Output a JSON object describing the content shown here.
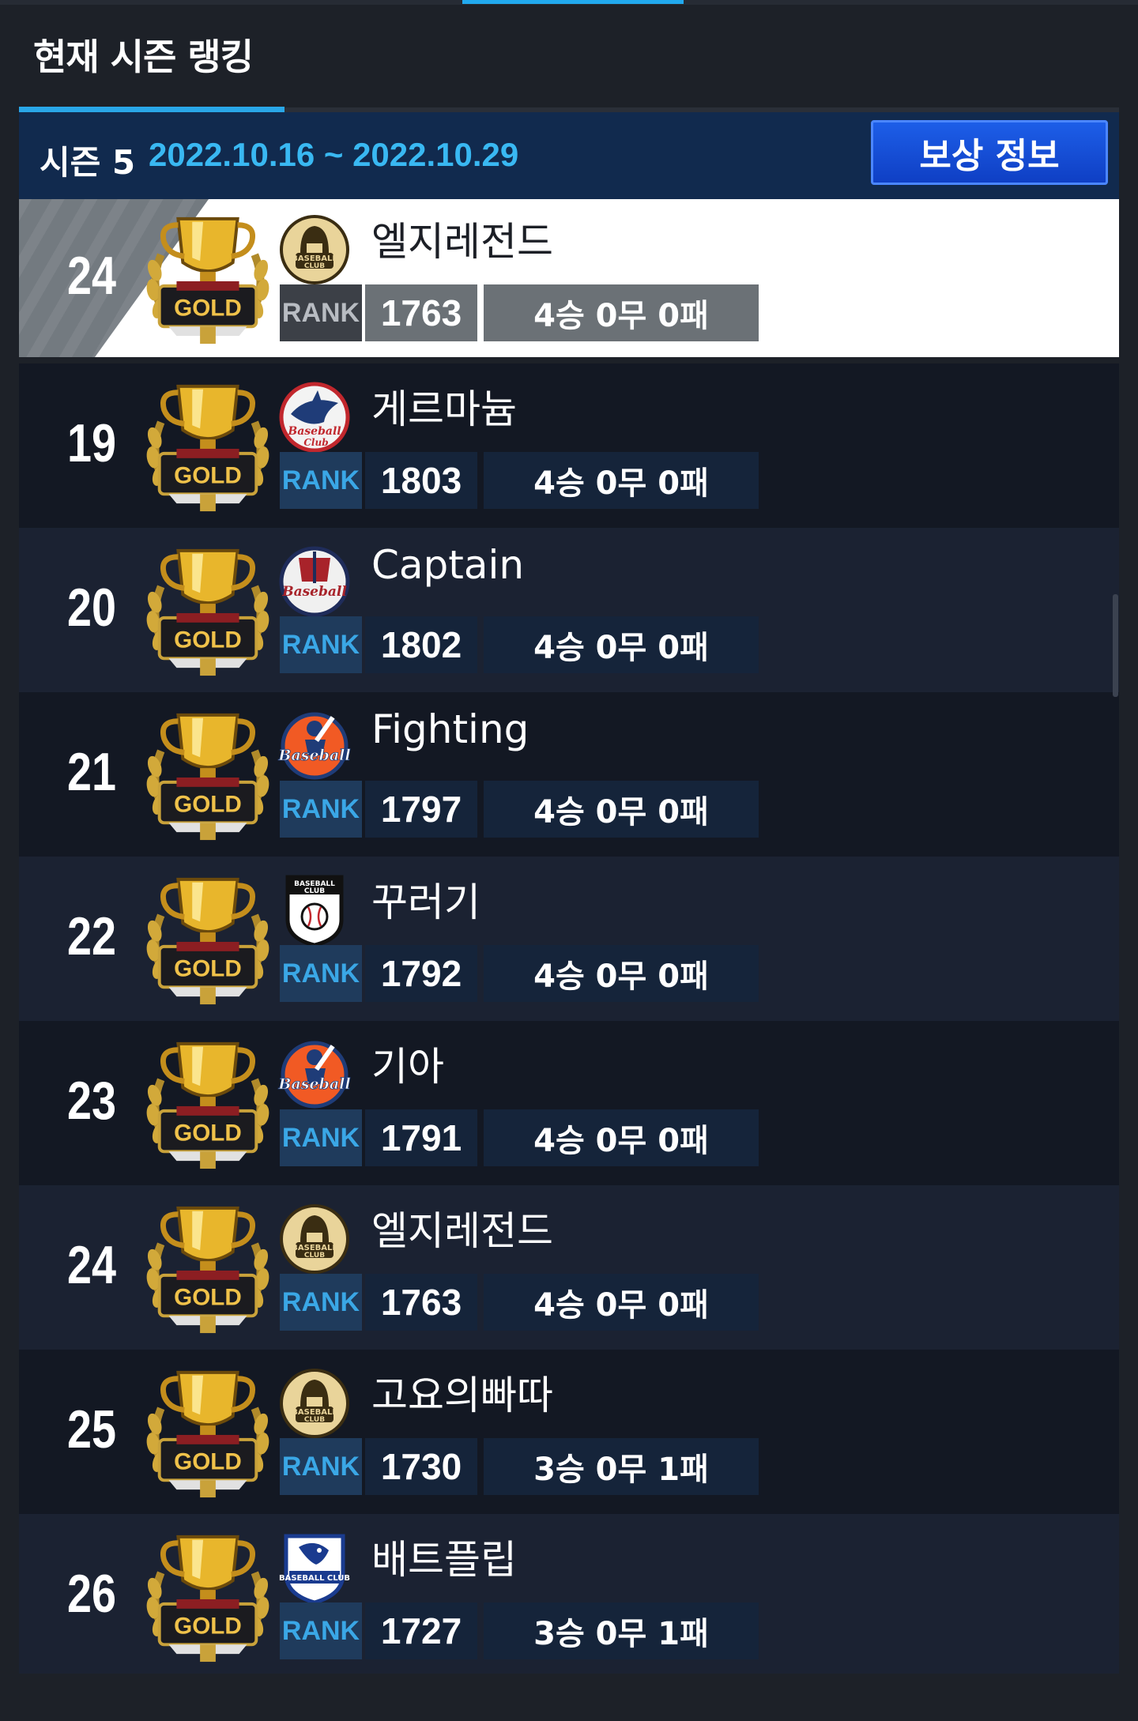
{
  "header": {
    "title": "현재 시즌 랭킹",
    "season_label": "시즌 5",
    "season_dates": "2022.10.16 ~ 2022.10.29",
    "reward_button": "보상 정보"
  },
  "colors": {
    "accent": "#29a7e8",
    "button": "#1553d8",
    "row_dark": "#131823",
    "row_light": "#1b2232"
  },
  "my_entry": {
    "rank": "24",
    "tier": "GOLD",
    "club_icon": "spartan-helmet-icon",
    "name": "엘지레전드",
    "rank_label": "RANK",
    "score": "1763",
    "record": "4승 0무 0패"
  },
  "entries": [
    {
      "rank": "19",
      "tier": "GOLD",
      "club_icon": "shark-icon",
      "name": "게르마늄",
      "rank_label": "RANK",
      "score": "1803",
      "record": "4승 0무 0패"
    },
    {
      "rank": "20",
      "tier": "GOLD",
      "club_icon": "pirate-ship-icon",
      "name": "Captain",
      "rank_label": "RANK",
      "score": "1802",
      "record": "4승 0무 0패"
    },
    {
      "rank": "21",
      "tier": "GOLD",
      "club_icon": "batter-icon",
      "name": "Fighting",
      "rank_label": "RANK",
      "score": "1797",
      "record": "4승 0무 0패"
    },
    {
      "rank": "22",
      "tier": "GOLD",
      "club_icon": "shield-baseball-icon",
      "name": "꾸러기",
      "rank_label": "RANK",
      "score": "1792",
      "record": "4승 0무 0패"
    },
    {
      "rank": "23",
      "tier": "GOLD",
      "club_icon": "batter-icon",
      "name": "기아",
      "rank_label": "RANK",
      "score": "1791",
      "record": "4승 0무 0패"
    },
    {
      "rank": "24",
      "tier": "GOLD",
      "club_icon": "spartan-helmet-icon",
      "name": "엘지레전드",
      "rank_label": "RANK",
      "score": "1763",
      "record": "4승 0무 0패"
    },
    {
      "rank": "25",
      "tier": "GOLD",
      "club_icon": "spartan-helmet-icon",
      "name": "고요의빠따",
      "rank_label": "RANK",
      "score": "1730",
      "record": "3승 0무 1패"
    },
    {
      "rank": "26",
      "tier": "GOLD",
      "club_icon": "eagle-shield-icon",
      "name": "배트플립",
      "rank_label": "RANK",
      "score": "1727",
      "record": "3승 0무 1패"
    }
  ]
}
